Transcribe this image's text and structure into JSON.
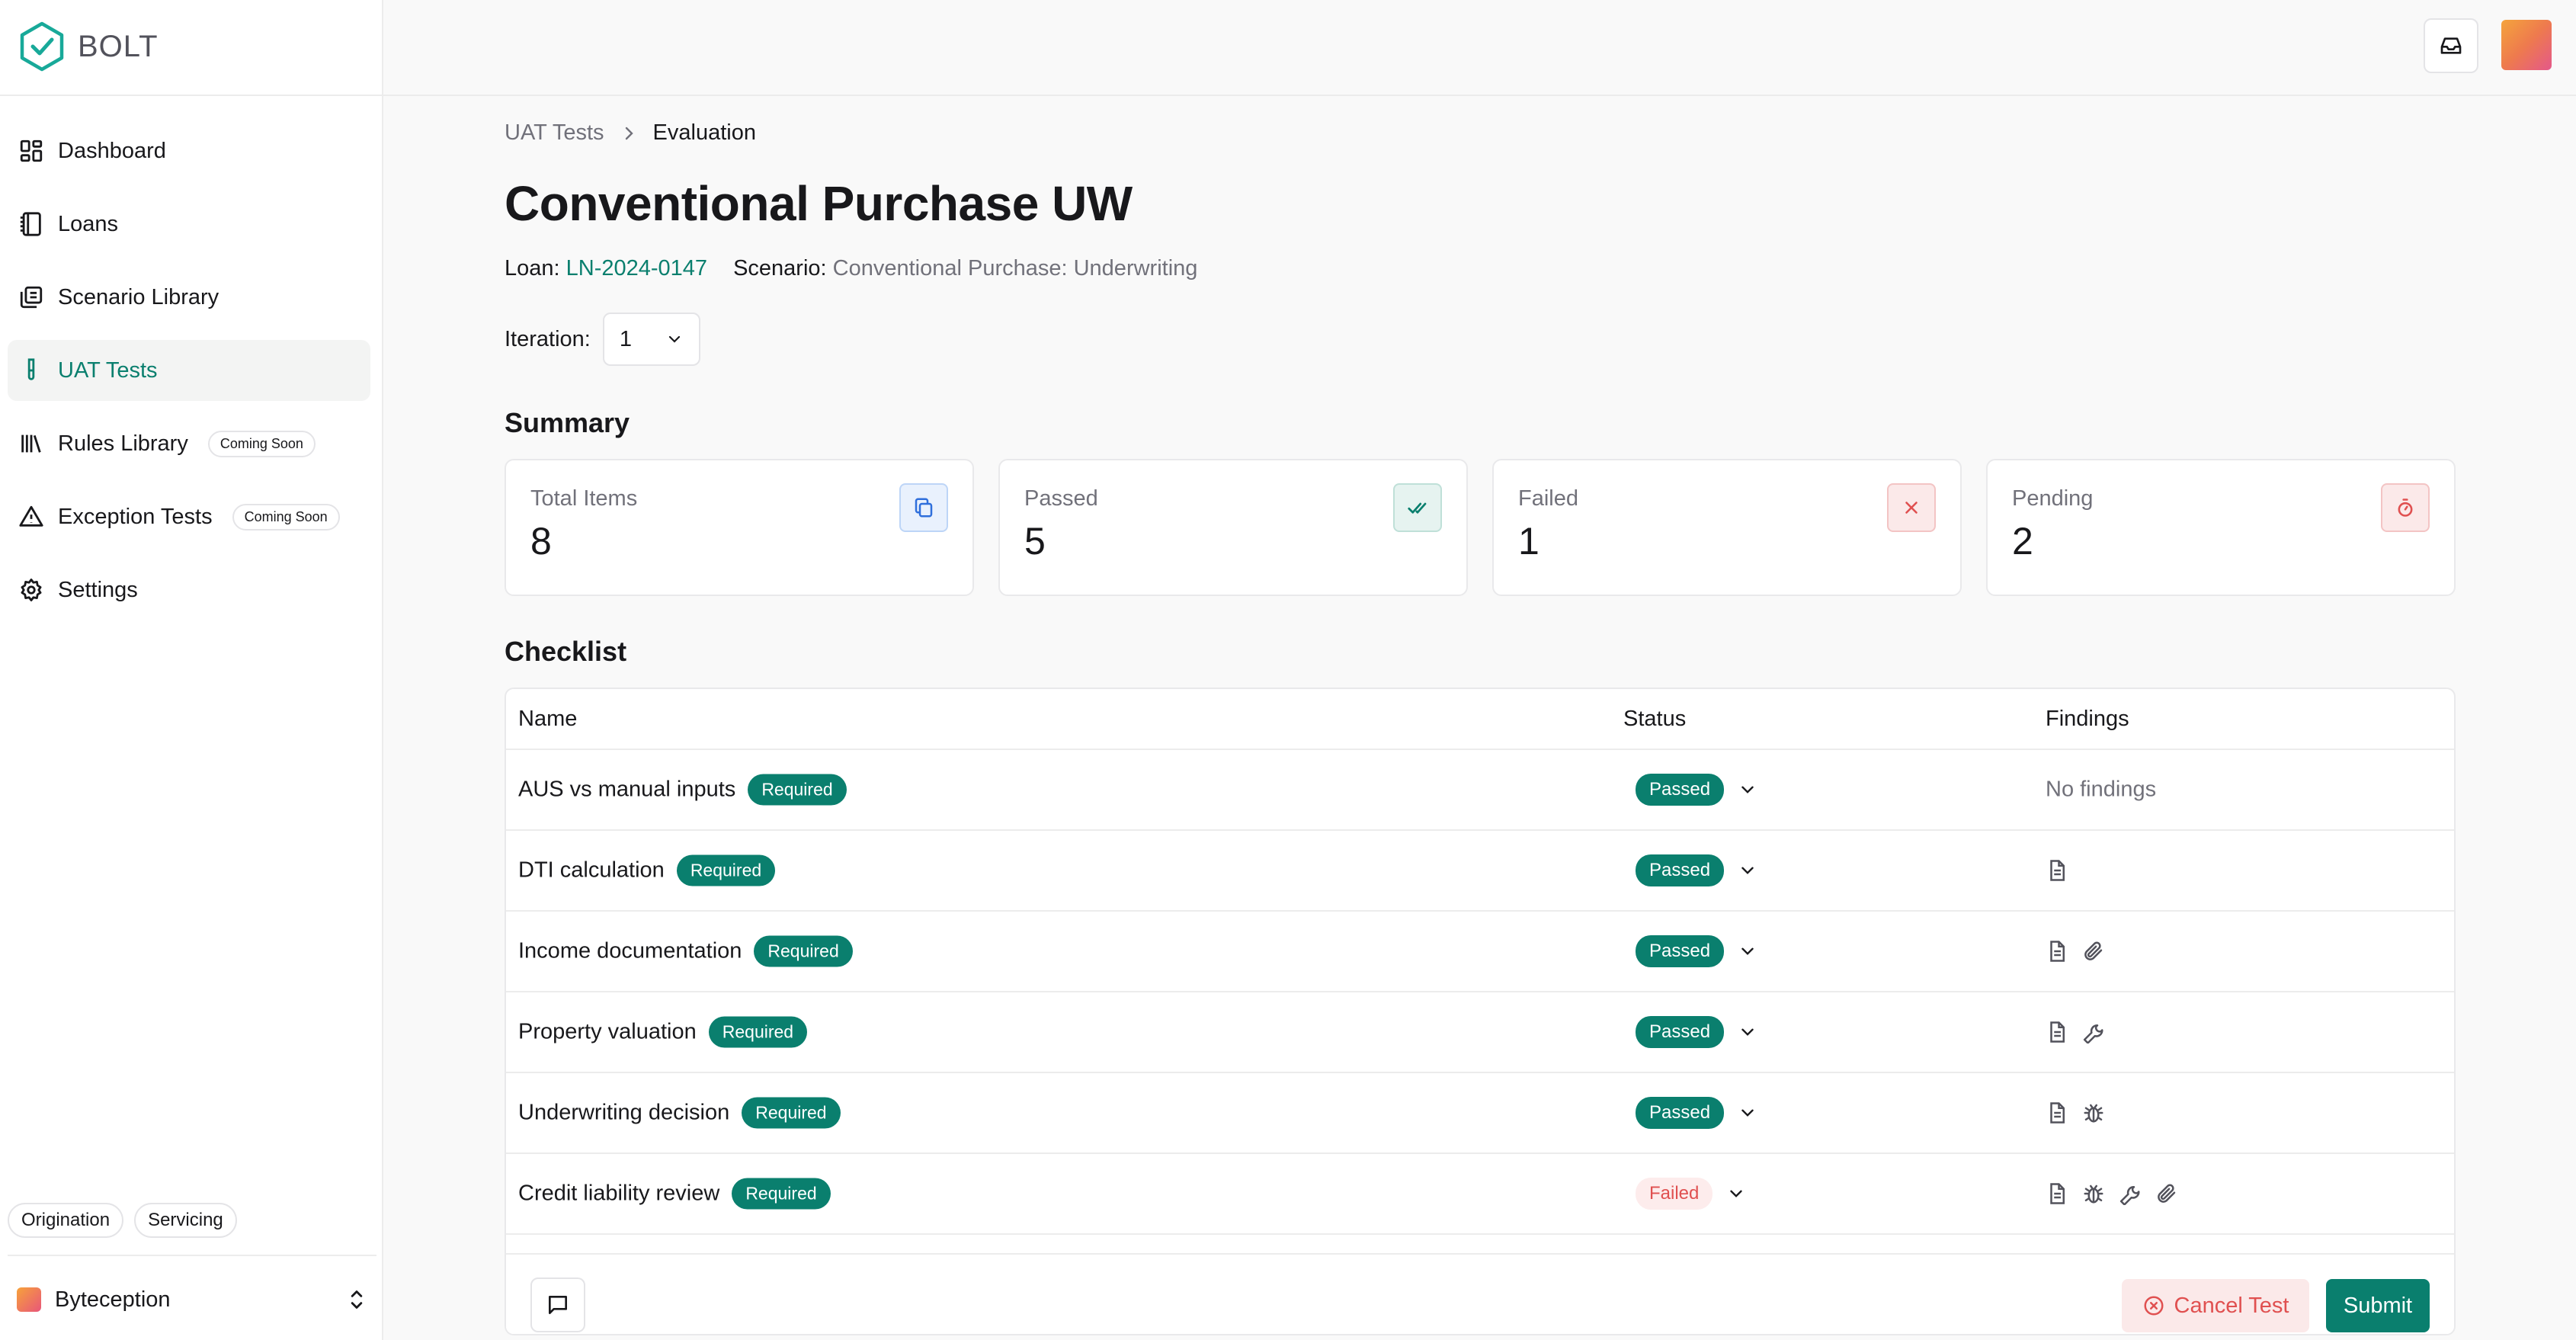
{
  "brand": {
    "name": "BOLT",
    "icon": "hexagon-check-icon",
    "color": "#18a999"
  },
  "sidebar": {
    "items": [
      {
        "label": "Dashboard",
        "icon": "dashboard-icon"
      },
      {
        "label": "Loans",
        "icon": "notebook-icon"
      },
      {
        "label": "Scenario Library",
        "icon": "library-icon"
      },
      {
        "label": "UAT Tests",
        "icon": "test-tube-icon",
        "active": true
      },
      {
        "label": "Rules Library",
        "icon": "books-icon",
        "badge": "Coming Soon"
      },
      {
        "label": "Exception Tests",
        "icon": "warning-icon",
        "badge": "Coming Soon"
      },
      {
        "label": "Settings",
        "icon": "gear-icon"
      }
    ],
    "env_tags": [
      "Origination",
      "Servicing"
    ],
    "org": {
      "name": "Byteception"
    }
  },
  "breadcrumb": {
    "parent": "UAT Tests",
    "current": "Evaluation"
  },
  "page": {
    "title": "Conventional Purchase UW",
    "loan_label": "Loan:",
    "loan_value": "LN-2024-0147",
    "scenario_label": "Scenario:",
    "scenario_value": "Conventional Purchase: Underwriting",
    "iteration_label": "Iteration:",
    "iteration_value": "1"
  },
  "summary": {
    "title": "Summary",
    "cards": [
      {
        "label": "Total Items",
        "value": "8",
        "icon": "copy-icon",
        "color": "#2f6fdc"
      },
      {
        "label": "Passed",
        "value": "5",
        "icon": "double-check-icon",
        "color": "#0a7f6e"
      },
      {
        "label": "Failed",
        "value": "1",
        "icon": "x-icon",
        "color": "#e05050"
      },
      {
        "label": "Pending",
        "value": "2",
        "icon": "timer-icon",
        "color": "#e05050"
      }
    ]
  },
  "checklist": {
    "title": "Checklist",
    "columns": {
      "name": "Name",
      "status": "Status",
      "findings": "Findings"
    },
    "rows": [
      {
        "name": "AUS vs manual inputs",
        "badge": "Required",
        "status": "Passed",
        "findings_text": "No findings",
        "finding_icons": []
      },
      {
        "name": "DTI calculation",
        "badge": "Required",
        "status": "Passed",
        "findings_text": "",
        "finding_icons": [
          "document-icon"
        ]
      },
      {
        "name": "Income documentation",
        "badge": "Required",
        "status": "Passed",
        "findings_text": "",
        "finding_icons": [
          "document-icon",
          "paperclip-icon"
        ]
      },
      {
        "name": "Property valuation",
        "badge": "Required",
        "status": "Passed",
        "findings_text": "",
        "finding_icons": [
          "document-icon",
          "wrench-icon"
        ]
      },
      {
        "name": "Underwriting decision",
        "badge": "Required",
        "status": "Passed",
        "findings_text": "",
        "finding_icons": [
          "document-icon",
          "bug-icon"
        ]
      },
      {
        "name": "Credit liability review",
        "badge": "Required",
        "status": "Failed",
        "findings_text": "",
        "finding_icons": [
          "document-icon",
          "bug-icon",
          "wrench-icon",
          "paperclip-icon"
        ]
      }
    ]
  },
  "actions": {
    "cancel_label": "Cancel Test",
    "submit_label": "Submit"
  },
  "colors": {
    "accent": "#0a7f6e",
    "danger": "#e05050"
  }
}
